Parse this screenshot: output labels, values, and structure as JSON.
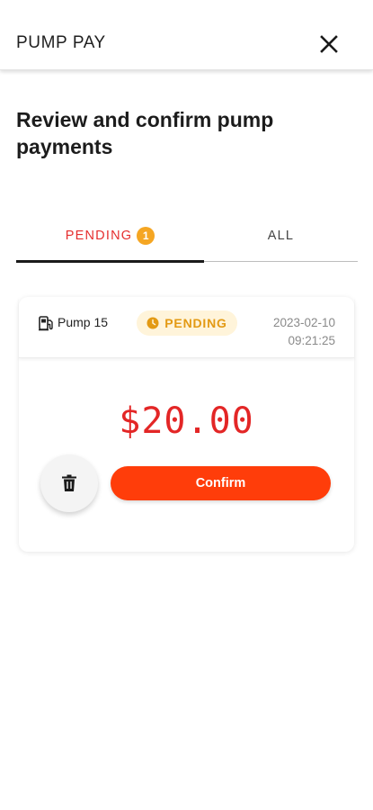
{
  "app_bar": {
    "title": "PUMP PAY",
    "close_icon": "close-icon"
  },
  "page": {
    "heading": "Review and confirm pump payments"
  },
  "tabs": [
    {
      "label": "PENDING",
      "badge": "1",
      "active": true
    },
    {
      "label": "ALL",
      "active": false
    }
  ],
  "payment": {
    "pump_label": "Pump 15",
    "pump_icon": "fuel-pump-icon",
    "status": "PENDING",
    "status_icon": "clock-icon",
    "date": "2023-02-10",
    "time": "09:21:25",
    "amount": "$20.00",
    "delete_icon": "trash-icon",
    "confirm_label": "Confirm"
  },
  "colors": {
    "accent_tab": "#e52e2e",
    "badge": "#f5a623",
    "status_text": "#e39a14",
    "status_bg": "#fff4da",
    "amount": "#e32626",
    "confirm_button": "#ff3d0a"
  }
}
